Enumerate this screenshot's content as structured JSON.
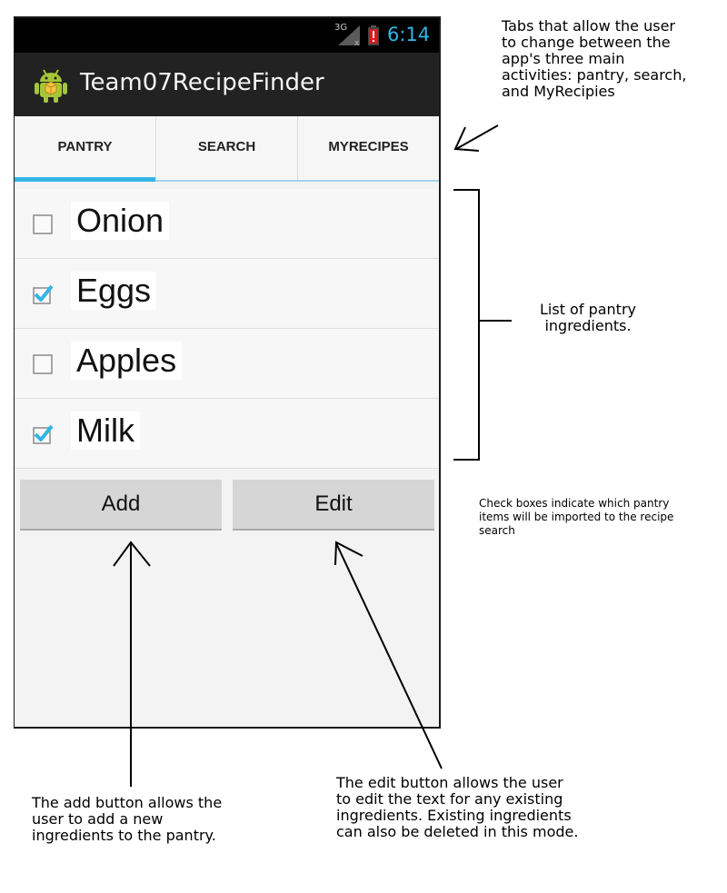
{
  "status_bar": {
    "network_label": "3G",
    "time": "6:14",
    "clock_color": "#33b5e5"
  },
  "app": {
    "title": "Team07RecipeFinder",
    "icon": "android-icon"
  },
  "tabs": [
    {
      "label": "PANTRY",
      "active": true
    },
    {
      "label": "SEARCH",
      "active": false
    },
    {
      "label": "MYRECIPES",
      "active": false
    }
  ],
  "accent_color": "#33b5e5",
  "pantry": {
    "items": [
      {
        "label": "Onion",
        "checked": false
      },
      {
        "label": "Eggs",
        "checked": true
      },
      {
        "label": "Apples",
        "checked": false
      },
      {
        "label": "Milk",
        "checked": true
      }
    ]
  },
  "buttons": {
    "add_label": "Add",
    "edit_label": "Edit"
  },
  "annotations": {
    "tabs_note": "Tabs that allow the user\nto change between the\napp's three main\nactivities: pantry, search,\nand MyRecipies",
    "list_note": "List of pantry\ningredients.",
    "checkbox_note": "Check boxes indicate which pantry\nitems will be imported to the recipe\nsearch",
    "add_note": "The add button allows the\nuser to add a new\ningredients to the pantry.",
    "edit_note": "The edit button allows the user\nto edit the text for any existing\ningredients. Existing ingredients\ncan also be deleted in this mode."
  }
}
